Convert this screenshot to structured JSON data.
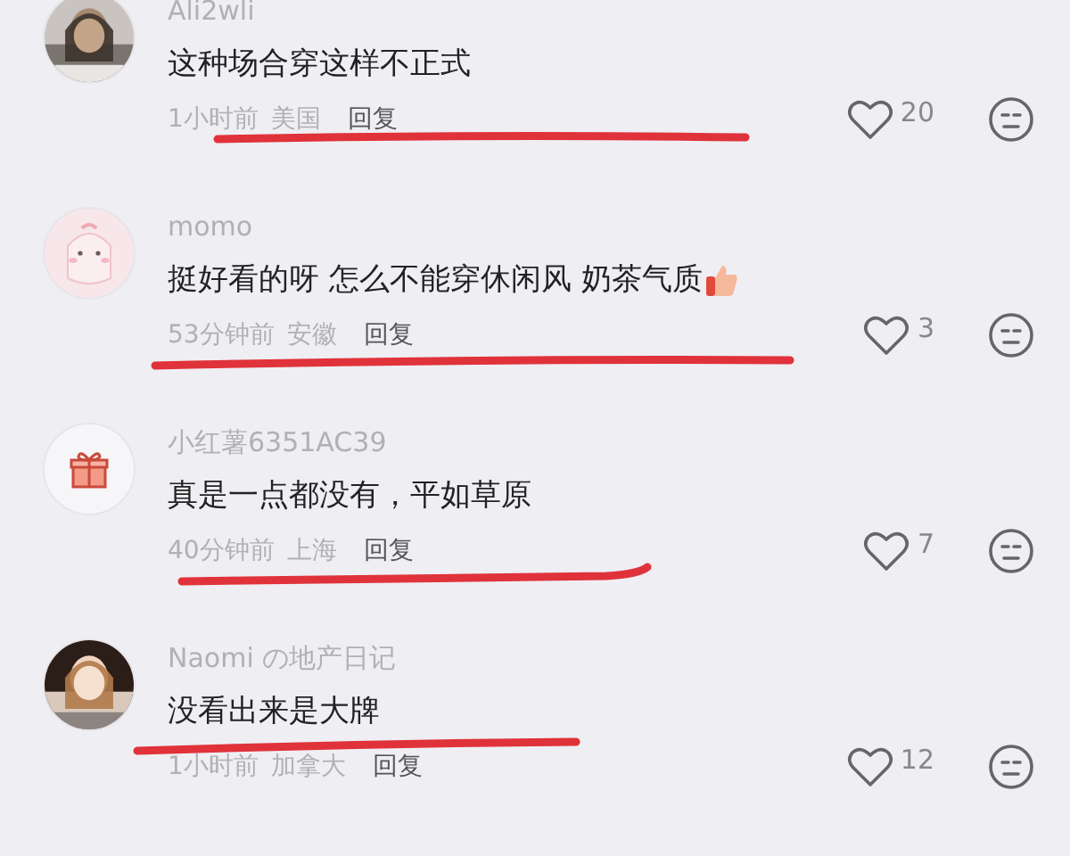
{
  "comments": [
    {
      "name": "Ali2wli",
      "text": "这种场合穿这样不正式",
      "emoji": false,
      "time": "1小时前",
      "region": "美国",
      "reply": "回复",
      "likes": "20",
      "underlined": true
    },
    {
      "avatar": {
        "kind": "cartoon"
      },
      "name": "momo",
      "text": "挺好看的呀 怎么不能穿休闲风 奶茶气质",
      "emoji": true,
      "time": "53分钟前",
      "region": "安徽",
      "reply": "回复",
      "likes": "3",
      "underlined": true
    },
    {
      "avatar": {
        "kind": "gift"
      },
      "name": "小红薯6351AC39",
      "text": "真是一点都没有，平如草原",
      "emoji": false,
      "time": "40分钟前",
      "region": "上海",
      "reply": "回复",
      "likes": "7",
      "underlined": true
    },
    {
      "avatar": {
        "kind": "photo2"
      },
      "name": "Naomi の地产日记",
      "text": "没看出来是大牌",
      "emoji": false,
      "time": "1小时前",
      "region": "加拿大",
      "reply": "回复",
      "likes": "12",
      "underlined": true
    }
  ]
}
